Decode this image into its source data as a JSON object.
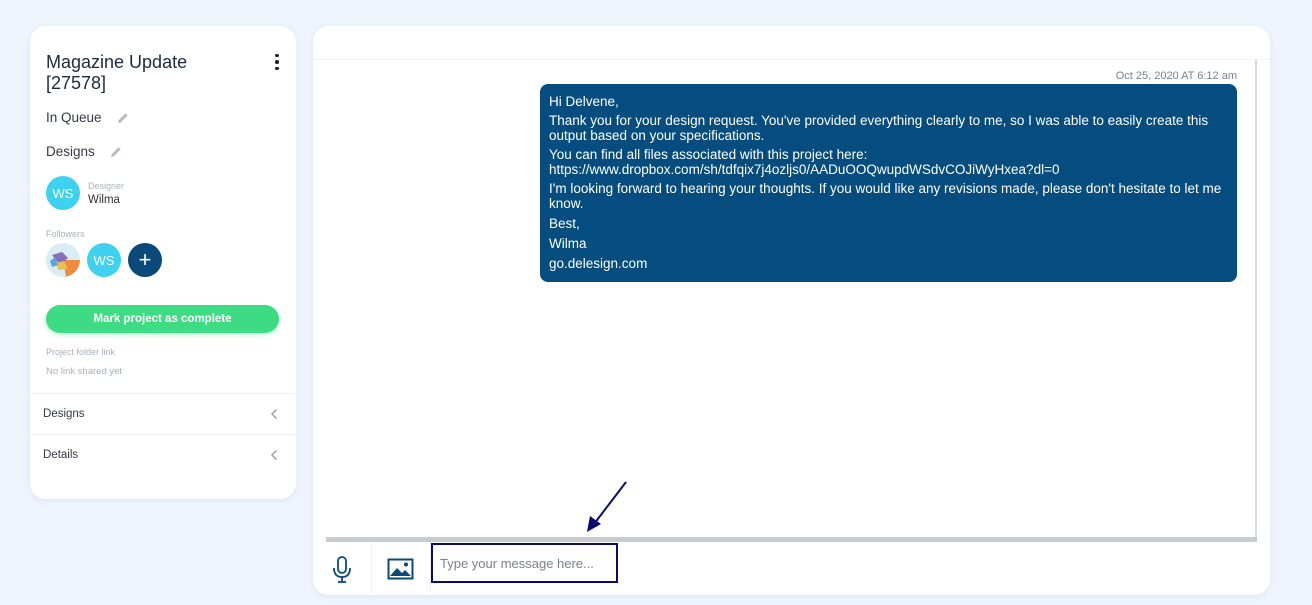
{
  "project": {
    "title": "Magazine Update [27578]",
    "status": "In Queue",
    "category": "Designs",
    "designer_label": "Designer",
    "designer_name": "Wilma",
    "designer_initials": "WS",
    "followers_label": "Followers",
    "followers": [
      {
        "type": "photo"
      },
      {
        "type": "initials",
        "initials": "WS"
      }
    ],
    "add_follower_glyph": "+",
    "complete_button": "Mark project as complete",
    "folder_label": "Project folder link",
    "folder_value": "No link shared yet",
    "sections": [
      {
        "label": "Designs"
      },
      {
        "label": "Details"
      }
    ]
  },
  "chat": {
    "timestamp": "Oct 25, 2020 AT 6:12 am",
    "message_lines": [
      "Hi Delvene,",
      "Thank you for your design request. You've provided everything clearly to me, so I was able to easily create this output based on your specifications.",
      "You can find all files associated with this project here: https://www.dropbox.com/sh/tdfqix7j4ozljs0/AADuOOQwupdWSdvCOJiWyHxea?dl=0",
      "I'm looking forward to hearing your thoughts. If you would like any revisions made, please don't hesitate to let me know.",
      "Best,",
      "Wilma",
      "go.delesign.com"
    ]
  },
  "composer": {
    "placeholder": "Type your message here...",
    "value": ""
  },
  "icons": {
    "kebab": "more-vertical-icon",
    "pencil": "pencil-icon",
    "chevron": "chevron-left-icon",
    "mic": "microphone-icon",
    "image": "image-icon",
    "arrow": "annotation-arrow"
  },
  "colors": {
    "accent_green": "#3ddc84",
    "bubble_blue": "#054d7e",
    "avatar_cyan": "#3ed2f0",
    "add_button": "#0a4a7a",
    "input_border": "#0a0a6e"
  }
}
